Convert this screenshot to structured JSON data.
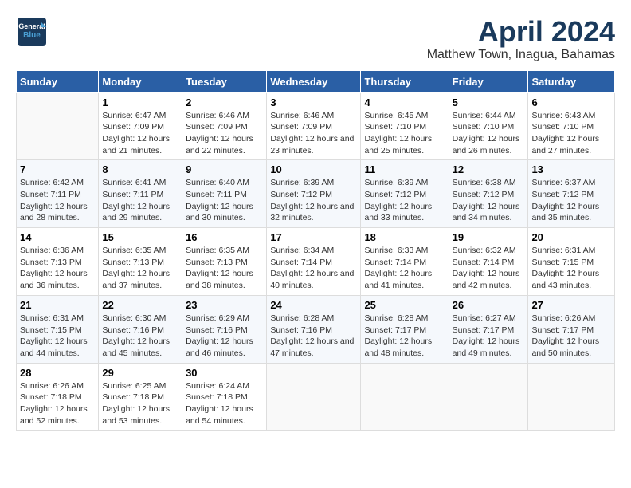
{
  "logo": {
    "line1": "General",
    "line2": "Blue"
  },
  "title": "April 2024",
  "location": "Matthew Town, Inagua, Bahamas",
  "weekdays": [
    "Sunday",
    "Monday",
    "Tuesday",
    "Wednesday",
    "Thursday",
    "Friday",
    "Saturday"
  ],
  "weeks": [
    [
      {
        "day": "",
        "sunrise": "",
        "sunset": "",
        "daylight": ""
      },
      {
        "day": "1",
        "sunrise": "Sunrise: 6:47 AM",
        "sunset": "Sunset: 7:09 PM",
        "daylight": "Daylight: 12 hours and 21 minutes."
      },
      {
        "day": "2",
        "sunrise": "Sunrise: 6:46 AM",
        "sunset": "Sunset: 7:09 PM",
        "daylight": "Daylight: 12 hours and 22 minutes."
      },
      {
        "day": "3",
        "sunrise": "Sunrise: 6:46 AM",
        "sunset": "Sunset: 7:09 PM",
        "daylight": "Daylight: 12 hours and 23 minutes."
      },
      {
        "day": "4",
        "sunrise": "Sunrise: 6:45 AM",
        "sunset": "Sunset: 7:10 PM",
        "daylight": "Daylight: 12 hours and 25 minutes."
      },
      {
        "day": "5",
        "sunrise": "Sunrise: 6:44 AM",
        "sunset": "Sunset: 7:10 PM",
        "daylight": "Daylight: 12 hours and 26 minutes."
      },
      {
        "day": "6",
        "sunrise": "Sunrise: 6:43 AM",
        "sunset": "Sunset: 7:10 PM",
        "daylight": "Daylight: 12 hours and 27 minutes."
      }
    ],
    [
      {
        "day": "7",
        "sunrise": "Sunrise: 6:42 AM",
        "sunset": "Sunset: 7:11 PM",
        "daylight": "Daylight: 12 hours and 28 minutes."
      },
      {
        "day": "8",
        "sunrise": "Sunrise: 6:41 AM",
        "sunset": "Sunset: 7:11 PM",
        "daylight": "Daylight: 12 hours and 29 minutes."
      },
      {
        "day": "9",
        "sunrise": "Sunrise: 6:40 AM",
        "sunset": "Sunset: 7:11 PM",
        "daylight": "Daylight: 12 hours and 30 minutes."
      },
      {
        "day": "10",
        "sunrise": "Sunrise: 6:39 AM",
        "sunset": "Sunset: 7:12 PM",
        "daylight": "Daylight: 12 hours and 32 minutes."
      },
      {
        "day": "11",
        "sunrise": "Sunrise: 6:39 AM",
        "sunset": "Sunset: 7:12 PM",
        "daylight": "Daylight: 12 hours and 33 minutes."
      },
      {
        "day": "12",
        "sunrise": "Sunrise: 6:38 AM",
        "sunset": "Sunset: 7:12 PM",
        "daylight": "Daylight: 12 hours and 34 minutes."
      },
      {
        "day": "13",
        "sunrise": "Sunrise: 6:37 AM",
        "sunset": "Sunset: 7:12 PM",
        "daylight": "Daylight: 12 hours and 35 minutes."
      }
    ],
    [
      {
        "day": "14",
        "sunrise": "Sunrise: 6:36 AM",
        "sunset": "Sunset: 7:13 PM",
        "daylight": "Daylight: 12 hours and 36 minutes."
      },
      {
        "day": "15",
        "sunrise": "Sunrise: 6:35 AM",
        "sunset": "Sunset: 7:13 PM",
        "daylight": "Daylight: 12 hours and 37 minutes."
      },
      {
        "day": "16",
        "sunrise": "Sunrise: 6:35 AM",
        "sunset": "Sunset: 7:13 PM",
        "daylight": "Daylight: 12 hours and 38 minutes."
      },
      {
        "day": "17",
        "sunrise": "Sunrise: 6:34 AM",
        "sunset": "Sunset: 7:14 PM",
        "daylight": "Daylight: 12 hours and 40 minutes."
      },
      {
        "day": "18",
        "sunrise": "Sunrise: 6:33 AM",
        "sunset": "Sunset: 7:14 PM",
        "daylight": "Daylight: 12 hours and 41 minutes."
      },
      {
        "day": "19",
        "sunrise": "Sunrise: 6:32 AM",
        "sunset": "Sunset: 7:14 PM",
        "daylight": "Daylight: 12 hours and 42 minutes."
      },
      {
        "day": "20",
        "sunrise": "Sunrise: 6:31 AM",
        "sunset": "Sunset: 7:15 PM",
        "daylight": "Daylight: 12 hours and 43 minutes."
      }
    ],
    [
      {
        "day": "21",
        "sunrise": "Sunrise: 6:31 AM",
        "sunset": "Sunset: 7:15 PM",
        "daylight": "Daylight: 12 hours and 44 minutes."
      },
      {
        "day": "22",
        "sunrise": "Sunrise: 6:30 AM",
        "sunset": "Sunset: 7:16 PM",
        "daylight": "Daylight: 12 hours and 45 minutes."
      },
      {
        "day": "23",
        "sunrise": "Sunrise: 6:29 AM",
        "sunset": "Sunset: 7:16 PM",
        "daylight": "Daylight: 12 hours and 46 minutes."
      },
      {
        "day": "24",
        "sunrise": "Sunrise: 6:28 AM",
        "sunset": "Sunset: 7:16 PM",
        "daylight": "Daylight: 12 hours and 47 minutes."
      },
      {
        "day": "25",
        "sunrise": "Sunrise: 6:28 AM",
        "sunset": "Sunset: 7:17 PM",
        "daylight": "Daylight: 12 hours and 48 minutes."
      },
      {
        "day": "26",
        "sunrise": "Sunrise: 6:27 AM",
        "sunset": "Sunset: 7:17 PM",
        "daylight": "Daylight: 12 hours and 49 minutes."
      },
      {
        "day": "27",
        "sunrise": "Sunrise: 6:26 AM",
        "sunset": "Sunset: 7:17 PM",
        "daylight": "Daylight: 12 hours and 50 minutes."
      }
    ],
    [
      {
        "day": "28",
        "sunrise": "Sunrise: 6:26 AM",
        "sunset": "Sunset: 7:18 PM",
        "daylight": "Daylight: 12 hours and 52 minutes."
      },
      {
        "day": "29",
        "sunrise": "Sunrise: 6:25 AM",
        "sunset": "Sunset: 7:18 PM",
        "daylight": "Daylight: 12 hours and 53 minutes."
      },
      {
        "day": "30",
        "sunrise": "Sunrise: 6:24 AM",
        "sunset": "Sunset: 7:18 PM",
        "daylight": "Daylight: 12 hours and 54 minutes."
      },
      {
        "day": "",
        "sunrise": "",
        "sunset": "",
        "daylight": ""
      },
      {
        "day": "",
        "sunrise": "",
        "sunset": "",
        "daylight": ""
      },
      {
        "day": "",
        "sunrise": "",
        "sunset": "",
        "daylight": ""
      },
      {
        "day": "",
        "sunrise": "",
        "sunset": "",
        "daylight": ""
      }
    ]
  ]
}
